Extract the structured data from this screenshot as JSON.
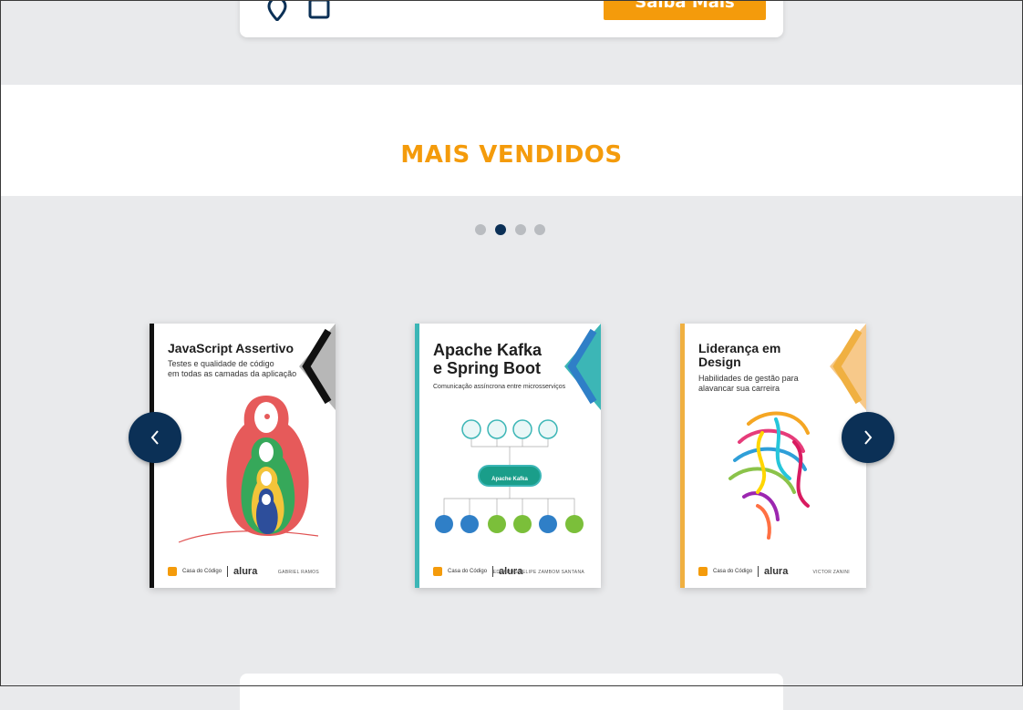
{
  "promo": {
    "button_label": "Saiba Mais",
    "icons": [
      "map-pin-icon",
      "calendar-icon"
    ]
  },
  "section": {
    "title": "MAIS VENDIDOS"
  },
  "carousel": {
    "dots": 4,
    "active_dot": 1,
    "prev_icon": "chevron-left-icon",
    "next_icon": "chevron-right-icon",
    "books": [
      {
        "title": "JavaScript Assertivo",
        "subtitle": "Testes e qualidade de código\nem todas as camadas da aplicação",
        "author": "GABRIEL RAMOS",
        "publisher_a": "Casa do Código",
        "publisher_b": "alura",
        "accent": "#111111"
      },
      {
        "title": "Apache Kafka\ne Spring Boot",
        "subtitle": "Comunicação assíncrona entre microsserviços",
        "author": "EDUARDO FELIPE ZAMBOM SANTANA",
        "publisher_a": "Casa do Código",
        "publisher_b": "alura",
        "accent": "#3cb6b6",
        "diagram_center": "Apache Kafka"
      },
      {
        "title": "Liderança em\nDesign",
        "subtitle": "Habilidades de gestão para\nalavancar sua carreira",
        "author": "VICTOR ZANINI",
        "publisher_a": "Casa do Código",
        "publisher_b": "alura",
        "accent": "#f0b041"
      }
    ]
  },
  "colors": {
    "accent": "#f49b0b",
    "navy": "#0b3056",
    "background": "#e9eaec"
  }
}
